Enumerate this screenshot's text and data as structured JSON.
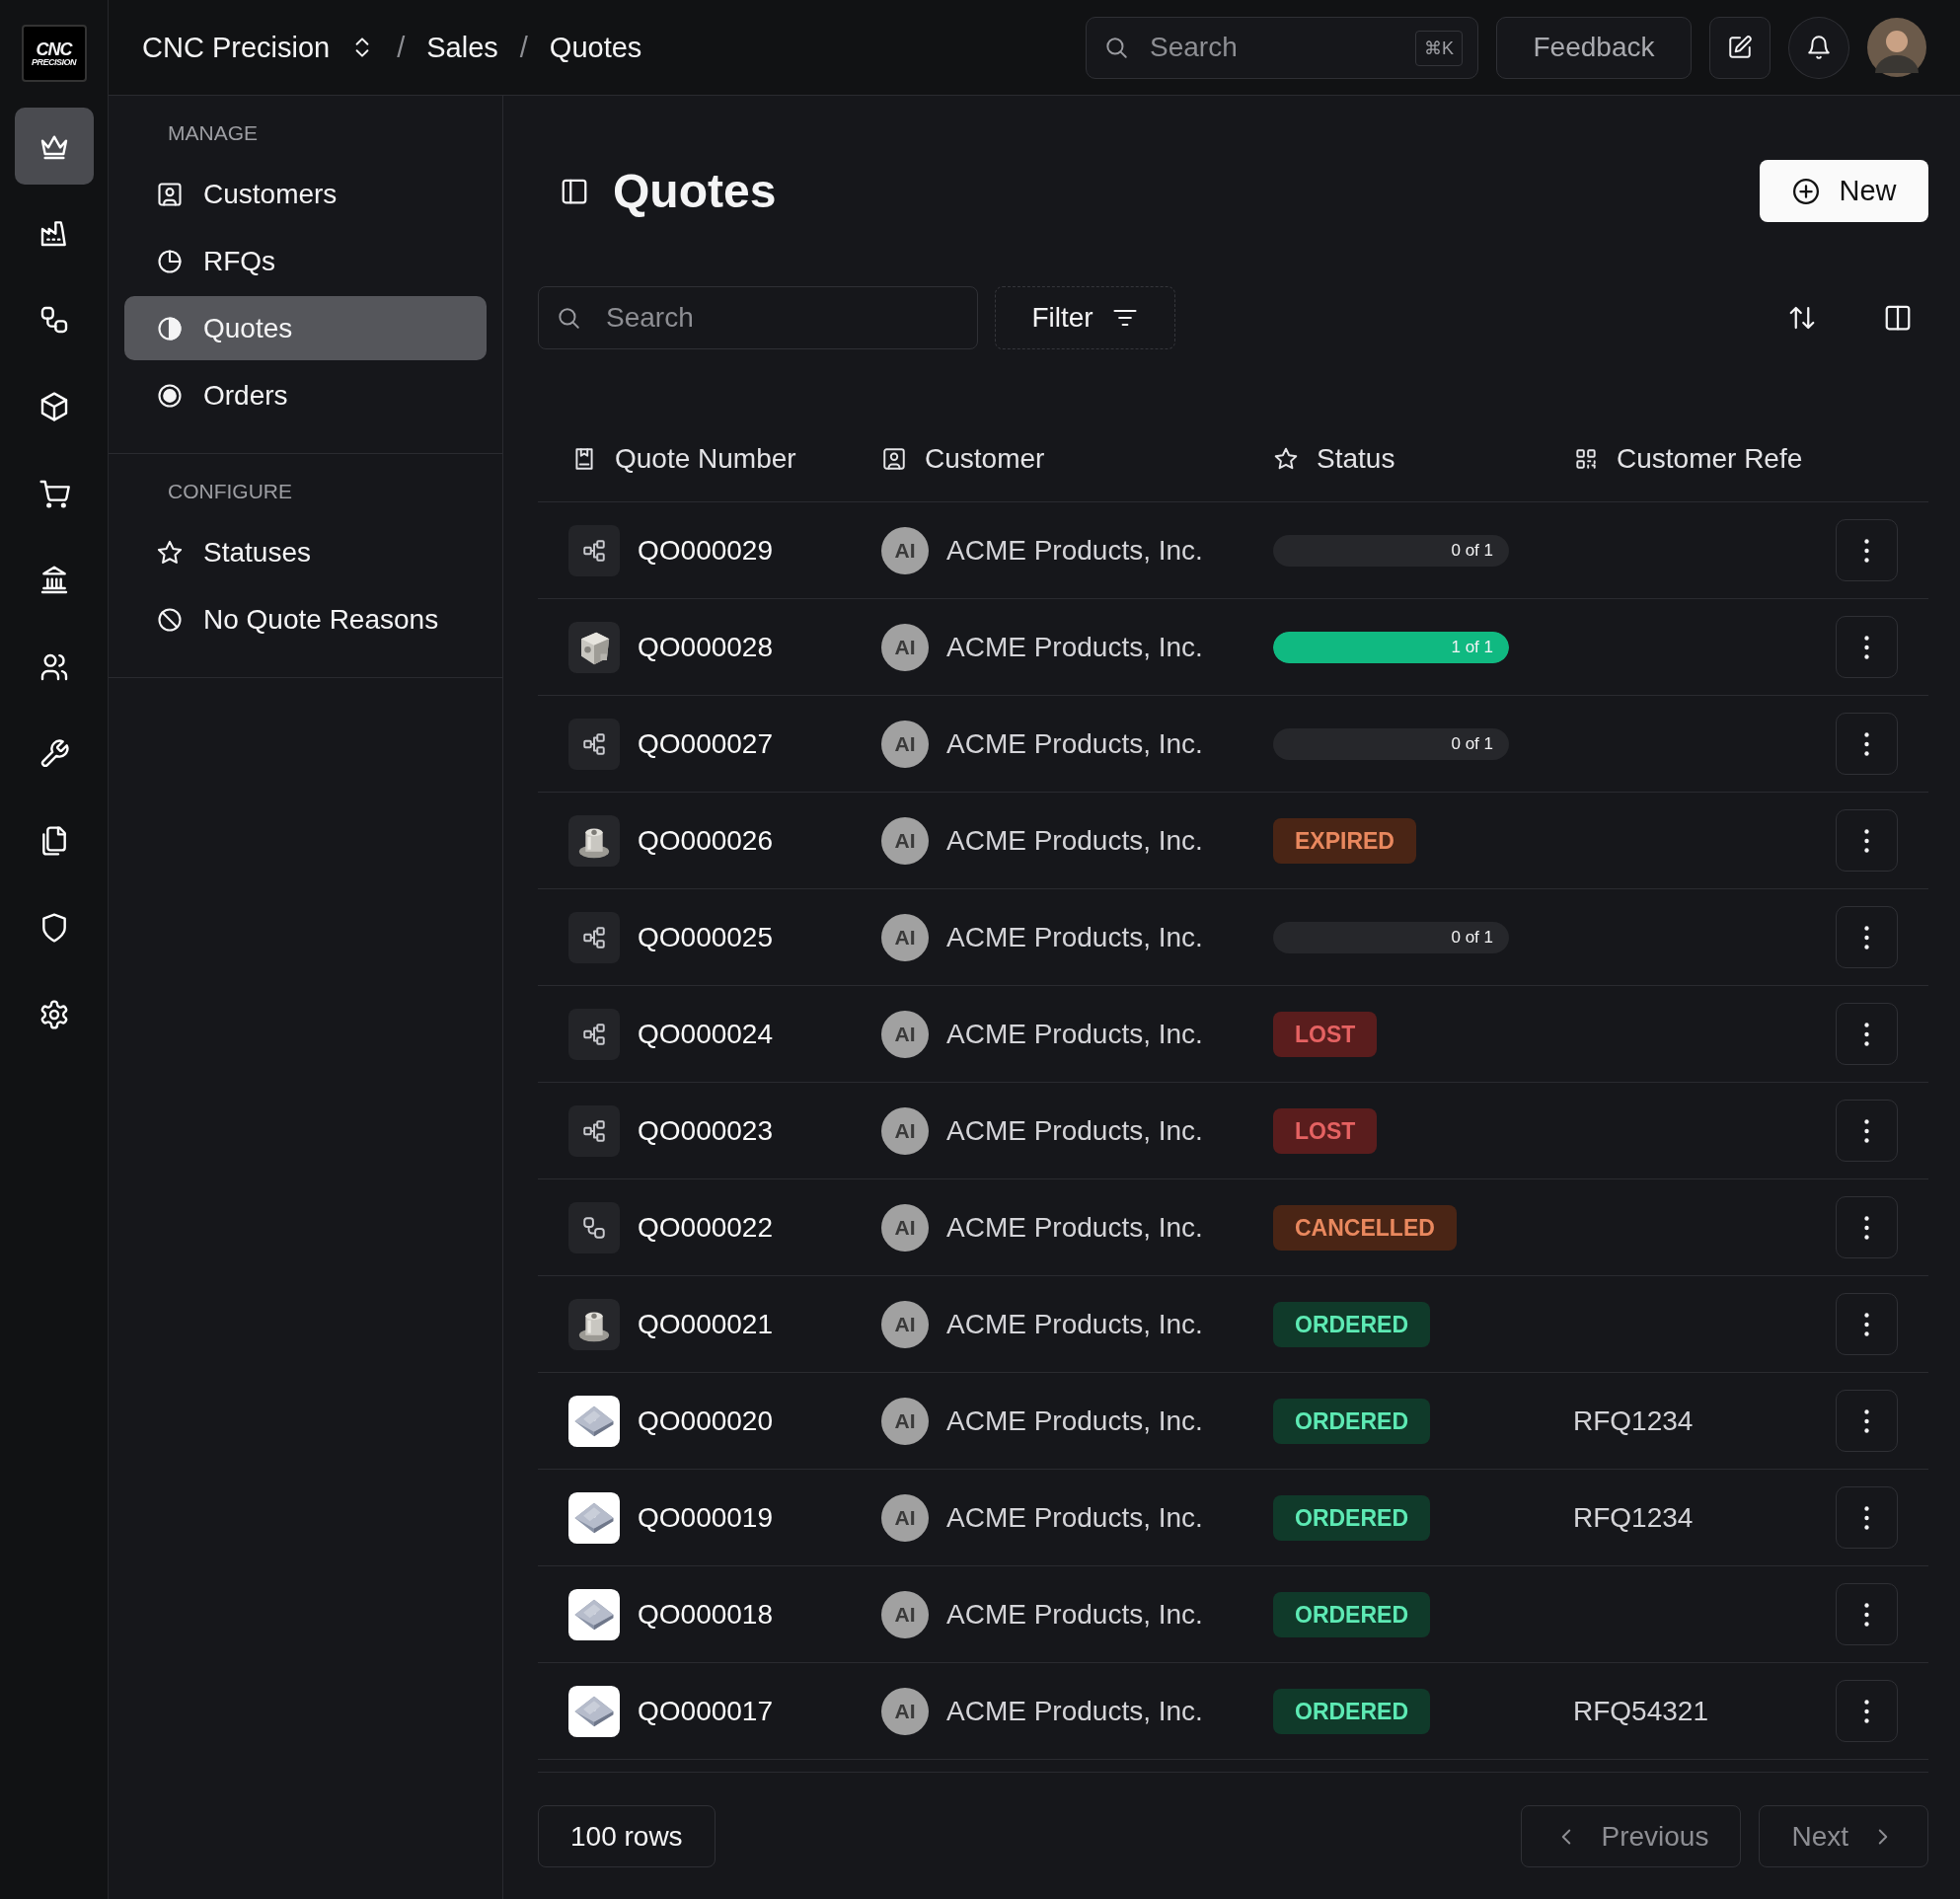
{
  "logo": {
    "line1": "CNC",
    "line2": "PRECISION"
  },
  "breadcrumb": {
    "org": "CNC Precision",
    "separator": "/",
    "items": [
      "Sales",
      "Quotes"
    ]
  },
  "top_search": {
    "placeholder": "Search",
    "shortcut": "⌘K"
  },
  "feedback_button": "Feedback",
  "rail": [
    {
      "selected": true
    },
    {
      "selected": false
    },
    {
      "selected": false
    },
    {
      "selected": false
    },
    {
      "selected": false
    },
    {
      "selected": false
    },
    {
      "selected": false
    },
    {
      "selected": false
    },
    {
      "selected": false
    },
    {
      "selected": false
    },
    {
      "selected": false
    }
  ],
  "sidebar": {
    "sections": [
      {
        "title": "MANAGE",
        "items": [
          {
            "label": "Customers",
            "selected": false
          },
          {
            "label": "RFQs",
            "selected": false
          },
          {
            "label": "Quotes",
            "selected": true
          },
          {
            "label": "Orders",
            "selected": false
          }
        ]
      },
      {
        "title": "CONFIGURE",
        "items": [
          {
            "label": "Statuses",
            "selected": false
          },
          {
            "label": "No Quote Reasons",
            "selected": false
          }
        ]
      }
    ]
  },
  "page_title": "Quotes",
  "new_button": "New",
  "search": {
    "placeholder": "Search"
  },
  "filter_button": "Filter",
  "table": {
    "columns": [
      "Quote Number",
      "Customer",
      "Status",
      "Customer Refe"
    ],
    "rows": [
      {
        "thumbnail": {
          "kind": "icon"
        },
        "number": "QO000029",
        "avatar": "AI",
        "customer": "ACME Products, Inc.",
        "status": {
          "kind": "progress",
          "level": 0,
          "reading": "0 of 1"
        }
      },
      {
        "number": "QO000028",
        "avatar": "AI",
        "customer": "ACME Products, Inc.",
        "status": {
          "kind": "progress",
          "level": 1,
          "reading": "1 of 1"
        }
      },
      {
        "thumbnail": {
          "kind": "icon"
        },
        "number": "QO000027",
        "avatar": "AI",
        "customer": "ACME Products, Inc.",
        "status": {
          "kind": "progress",
          "level": 0,
          "reading": "0 of 1"
        }
      },
      {
        "number": "QO000026",
        "avatar": "AI",
        "customer": "ACME Products, Inc.",
        "status": {
          "kind": "badge",
          "label": "EXPIRED",
          "color": "#4a2515"
        }
      },
      {
        "thumbnail": {
          "kind": "icon"
        },
        "number": "QO000025",
        "avatar": "AI",
        "customer": "ACME Products, Inc.",
        "status": {
          "kind": "progress",
          "level": 0,
          "reading": "0 of 1"
        }
      },
      {
        "thumbnail": {
          "kind": "icon"
        },
        "number": "QO000024",
        "avatar": "AI",
        "customer": "ACME Products, Inc.",
        "status": {
          "kind": "badge",
          "label": "LOST",
          "color": "#5a1d1d"
        }
      },
      {
        "thumbnail": {
          "kind": "icon"
        },
        "number": "QO000023",
        "avatar": "AI",
        "customer": "ACME Products, Inc.",
        "status": {
          "kind": "badge",
          "label": "LOST",
          "color": "#5a1d1d"
        }
      },
      {
        "thumbnail": {
          "kind": "icon"
        },
        "number": "QO000022",
        "avatar": "AI",
        "customer": "ACME Products, Inc.",
        "status": {
          "kind": "badge",
          "label": "CANCELLED",
          "color": "#4a2515"
        }
      },
      {
        "number": "QO000021",
        "avatar": "AI",
        "customer": "ACME Products, Inc.",
        "status": {
          "kind": "badge",
          "label": "ORDERED",
          "color": "#103a2a"
        }
      },
      {
        "number": "QO000020",
        "avatar": "AI",
        "customer": "ACME Products, Inc.",
        "status": {
          "kind": "badge",
          "label": "ORDERED",
          "color": "#103a2a"
        },
        "reference": "RFQ1234"
      },
      {
        "number": "QO000019",
        "avatar": "AI",
        "customer": "ACME Products, Inc.",
        "status": {
          "kind": "badge",
          "label": "ORDERED",
          "color": "#103a2a"
        },
        "reference": "RFQ1234"
      },
      {
        "number": "QO000018",
        "avatar": "AI",
        "customer": "ACME Products, Inc.",
        "status": {
          "kind": "badge",
          "label": "ORDERED",
          "color": "#103a2a"
        }
      },
      {
        "number": "QO000017",
        "avatar": "AI",
        "customer": "ACME Products, Inc.",
        "status": {
          "kind": "badge",
          "label": "ORDERED",
          "color": "#103a2a"
        },
        "reference": "RFQ54321"
      }
    ]
  },
  "footer": {
    "rows_button": "100 rows",
    "previous": "Previous",
    "next": "Next"
  }
}
